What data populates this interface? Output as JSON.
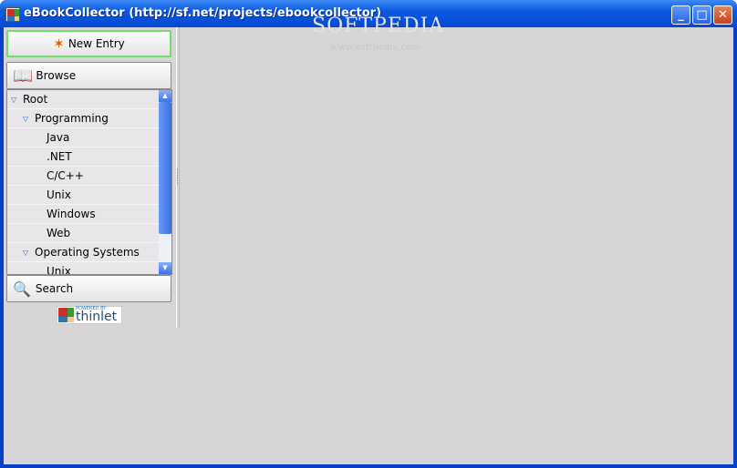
{
  "window": {
    "title": "eBookCollector (http://sf.net/projects/ebookcollector)",
    "minimize": "_",
    "maximize": "□",
    "close": "✕"
  },
  "toolbar": {
    "new_entry": "New Entry",
    "browse": "Browse",
    "search": "Search"
  },
  "tree": {
    "items": [
      {
        "label": "Root",
        "level": 0,
        "expanded": true
      },
      {
        "label": "Programming",
        "level": 1,
        "expanded": true
      },
      {
        "label": "Java",
        "level": 2
      },
      {
        "label": ".NET",
        "level": 2
      },
      {
        "label": "C/C++",
        "level": 2
      },
      {
        "label": "Unix",
        "level": 2
      },
      {
        "label": "Windows",
        "level": 2
      },
      {
        "label": "Web",
        "level": 2
      },
      {
        "label": "Operating Systems",
        "level": 1,
        "expanded": true
      },
      {
        "label": "Unix",
        "level": 2
      }
    ]
  },
  "logo": {
    "top": "POWERED BY",
    "name": "thinlet"
  },
  "watermark": {
    "brand": "SOFTPEDIA",
    "url": "www.softpedia.com"
  }
}
